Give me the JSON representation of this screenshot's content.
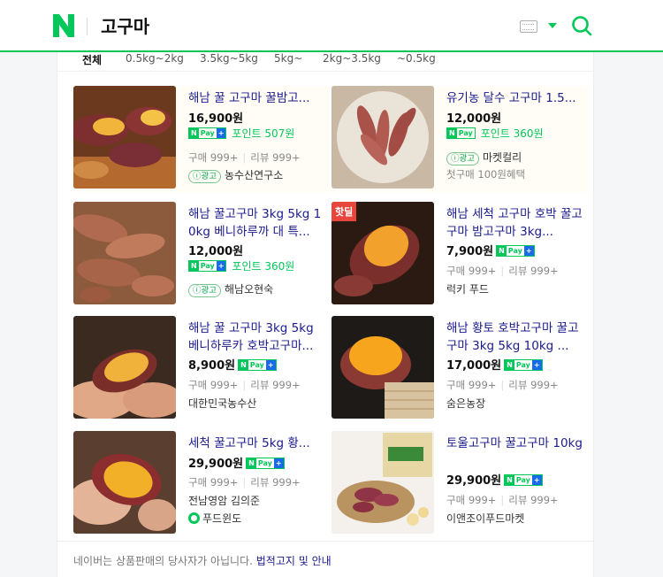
{
  "header": {
    "logo": "N",
    "query": "고구마"
  },
  "filters": [
    "전체",
    "0.5kg~2kg",
    "3.5kg~5kg",
    "5kg~",
    "2kg~3.5kg",
    "~0.5kg"
  ],
  "products": [
    {
      "title": "해남 꿀 고구마 꿀밤고...",
      "price": "16,900원",
      "npay": true,
      "point": "포인트 507원",
      "buy": "구매 999+",
      "review": "리뷰 999+",
      "ad": "광고",
      "seller": "농수산연구소",
      "benefit": ""
    },
    {
      "title": "유기농 달수 고구마 1.5...",
      "price": "12,000원",
      "npay": true,
      "point": "포인트 360원",
      "buy": "",
      "review": "",
      "ad": "광고",
      "seller": "마켓컬리",
      "benefit": "첫구매 100원혜택"
    },
    {
      "title": "해남 꿀고구마 3kg 5kg 10kg 베니하루까 대 특...",
      "price": "12,000원",
      "npay": true,
      "point": "포인트 360원",
      "buy": "",
      "review": "",
      "ad": "광고",
      "seller": "해남오현숙",
      "benefit": ""
    },
    {
      "title": "해남 세척 고구마 호박 꿀고구마 밤고구마 3kg...",
      "price": "7,900원",
      "npay": true,
      "point": "",
      "buy": "구매 999+",
      "review": "리뷰 999+",
      "ad": "",
      "seller": "럭키 푸드",
      "benefit": "",
      "badge": "핫딜"
    },
    {
      "title": "해남 꿀 고구마 3kg 5kg 베니하루카 호박고구마...",
      "price": "8,900원",
      "npay": true,
      "point": "",
      "buy": "구매 999+",
      "review": "리뷰 999+",
      "ad": "",
      "seller": "대한민국농수산",
      "benefit": ""
    },
    {
      "title": "해남 황토 호박고구마 꿀고구마 3kg 5kg 10kg ...",
      "price": "17,000원",
      "npay": true,
      "point": "",
      "buy": "구매 999+",
      "review": "리뷰 999+",
      "ad": "",
      "seller": "숨은농장",
      "benefit": ""
    },
    {
      "title": "세척 꿀고구마 5kg 황...",
      "price": "29,900원",
      "npay": true,
      "point": "",
      "buy": "구매 999+",
      "review": "리뷰 999+",
      "ad": "",
      "seller": "전남영암 김의준",
      "benefit": "",
      "store": "푸드윈도"
    },
    {
      "title": "토울고구마 꿀고구마 10kg",
      "price": "29,900원",
      "npay": true,
      "point": "",
      "buy": "구매 999+",
      "review": "리뷰 999+",
      "ad": "",
      "seller": "이앤조이푸드마켓",
      "benefit": ""
    }
  ],
  "npay_label": {
    "n": "N",
    "pay": "Pay",
    "plus": "+"
  },
  "footer": {
    "text": "네이버는 상품판매의 당사자가 아닙니다. ",
    "link": "법적고지 및 안내"
  },
  "colors": {
    "brand": "#03c75a",
    "title": "#1a1a8c"
  }
}
